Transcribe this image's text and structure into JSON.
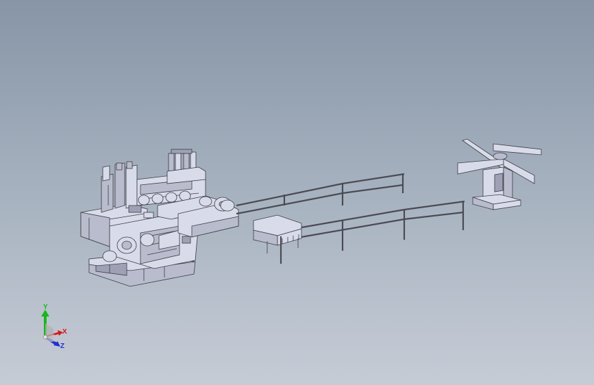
{
  "viewport": {
    "background_top": "#8795a6",
    "background_bottom": "#c6ccd6"
  },
  "model": {
    "fill_color": "#d8dbe9",
    "edge_color": "#3a3a42",
    "shadow_color": "#9ea1b6",
    "parts": [
      "leveler-feeder",
      "coil-cradle-table",
      "guide-rail-frame",
      "decoiler"
    ]
  },
  "triad": {
    "x_label": "X",
    "y_label": "Y",
    "z_label": "Z",
    "x_color": "#d81818",
    "y_color": "#18b818",
    "z_color": "#2030d0"
  }
}
